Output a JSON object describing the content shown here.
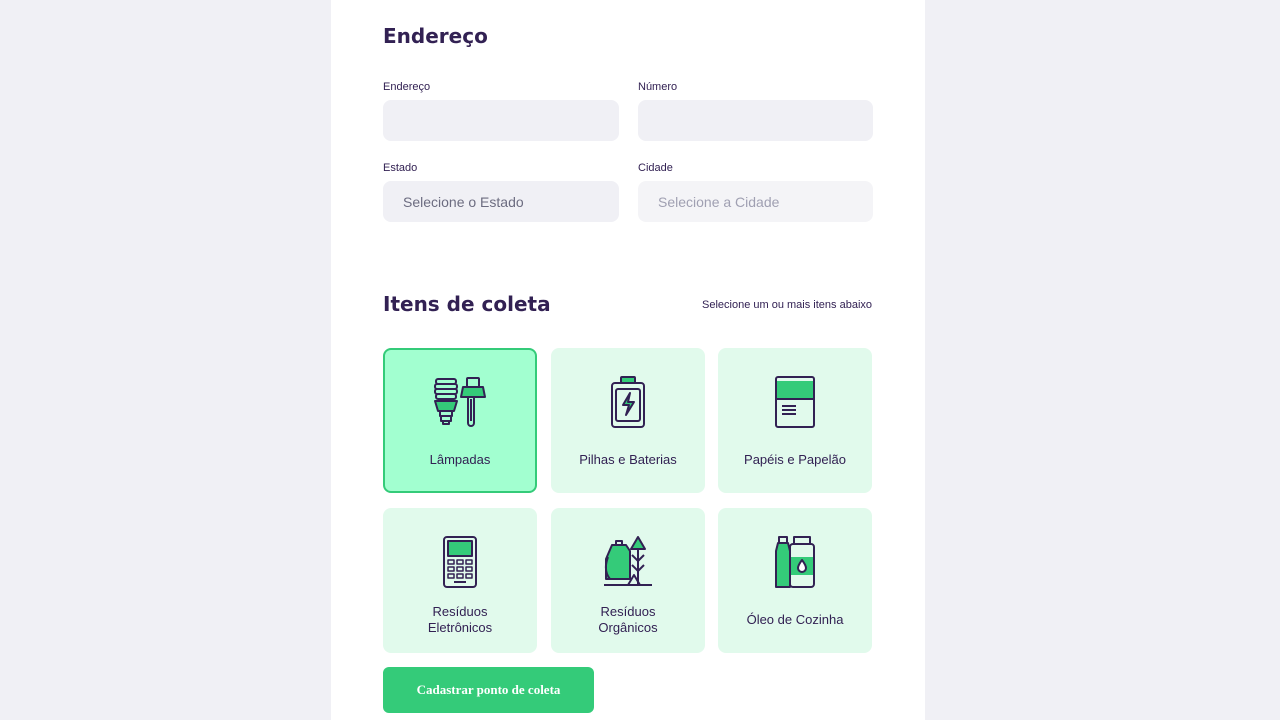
{
  "address_section": {
    "title": "Endereço",
    "address_label": "Endereço",
    "address_value": "",
    "number_label": "Número",
    "number_value": "",
    "state_label": "Estado",
    "state_placeholder": "Selecione o Estado",
    "city_label": "Cidade",
    "city_placeholder": "Selecione a Cidade"
  },
  "items_section": {
    "title": "Itens de coleta",
    "hint": "Selecione um ou mais itens abaixo",
    "items": [
      {
        "label": "Lâmpadas",
        "icon": "lamps-icon",
        "selected": true
      },
      {
        "label": "Pilhas e Baterias",
        "icon": "battery-icon",
        "selected": false
      },
      {
        "label": "Papéis e Papelão",
        "icon": "paper-icon",
        "selected": false
      },
      {
        "label_line1": "Resíduos",
        "label_line2": "Eletrônicos",
        "icon": "electronics-icon",
        "selected": false
      },
      {
        "label_line1": "Resíduos",
        "label_line2": "Orgânicos",
        "icon": "organic-icon",
        "selected": false
      },
      {
        "label": "Óleo de Cozinha",
        "icon": "oil-icon",
        "selected": false
      }
    ]
  },
  "submit_label": "Cadastrar ponto de coleta",
  "colors": {
    "primary": "#34cb79",
    "title": "#322153",
    "item_bg": "#e1faec",
    "item_selected_bg": "#a2ffd0",
    "page_bg": "#f0f0f5"
  }
}
